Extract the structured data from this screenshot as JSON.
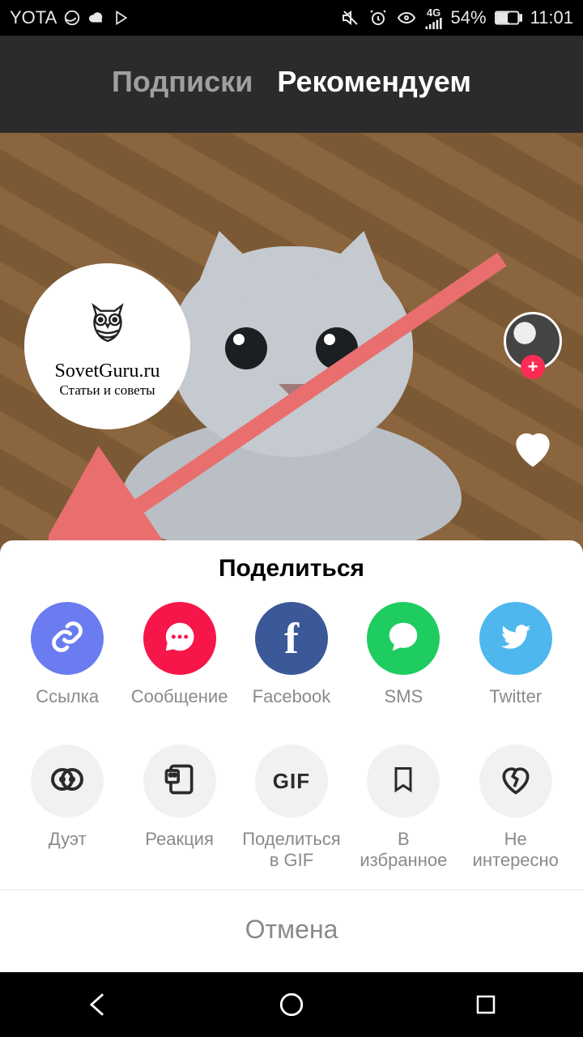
{
  "status": {
    "carrier": "YOTA",
    "network_label": "4G",
    "battery": "54%",
    "time": "11:01"
  },
  "tabs": {
    "following": "Подписки",
    "recommended": "Рекомендуем"
  },
  "badge": {
    "title": "SovetGuru.ru",
    "subtitle": "Статьи и советы"
  },
  "sheet": {
    "title": "Поделиться",
    "cancel": "Отмена",
    "primary": [
      {
        "label": "Ссылка",
        "color": "#6a7cf0",
        "icon": "link"
      },
      {
        "label": "Сообщение",
        "color": "#f6164a",
        "icon": "chat"
      },
      {
        "label": "Facebook",
        "color": "#3b5998",
        "icon": "facebook"
      },
      {
        "label": "SMS",
        "color": "#1fcc5f",
        "icon": "sms"
      },
      {
        "label": "Twitter",
        "color": "#4eb7ee",
        "icon": "twitter"
      }
    ],
    "secondary": [
      {
        "label": "Дуэт",
        "icon": "duet"
      },
      {
        "label": "Реакция",
        "icon": "react"
      },
      {
        "label": "Поделиться\nв GIF",
        "icon": "gif"
      },
      {
        "label": "В\nизбранное",
        "icon": "bookmark"
      },
      {
        "label": "Не\nинтересно",
        "icon": "heart-broken"
      }
    ]
  },
  "colors": {
    "accent_red": "#fe2c55",
    "arrow": "#e96f6f"
  }
}
